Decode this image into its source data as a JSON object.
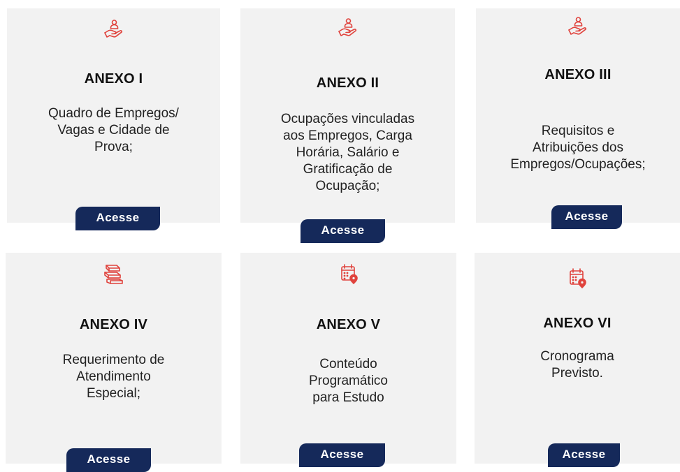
{
  "colors": {
    "card_bg": "#f2f2f2",
    "icon_red": "#e0433d",
    "button_bg": "#15295a",
    "button_text": "#ffffff"
  },
  "cards": [
    {
      "icon": "hand-person-icon",
      "title": "ANEXO I",
      "description": "Quadro de Empregos/\nVagas e Cidade de\nProva;",
      "button": "Acesse"
    },
    {
      "icon": "hand-person-icon",
      "title": "ANEXO II",
      "description": "Ocupações vinculadas\naos Empregos, Carga\nHorária, Salário e\nGratificação de\nOcupação;",
      "button": "Acesse"
    },
    {
      "icon": "hand-person-icon",
      "title": "ANEXO III",
      "description": "Requisitos e\nAtribuições dos\nEmpregos/Ocupações;",
      "button": "Acesse"
    },
    {
      "icon": "books-icon",
      "title": "ANEXO IV",
      "description": "Requerimento de\nAtendimento\nEspecial;",
      "button": "Acesse"
    },
    {
      "icon": "calendar-location-icon",
      "title": "ANEXO V",
      "description": "Conteúdo\nProgramático\npara Estudo",
      "button": "Acesse"
    },
    {
      "icon": "calendar-location-icon",
      "title": "ANEXO VI",
      "description": "Cronograma\nPrevisto.",
      "button": "Acesse"
    }
  ]
}
